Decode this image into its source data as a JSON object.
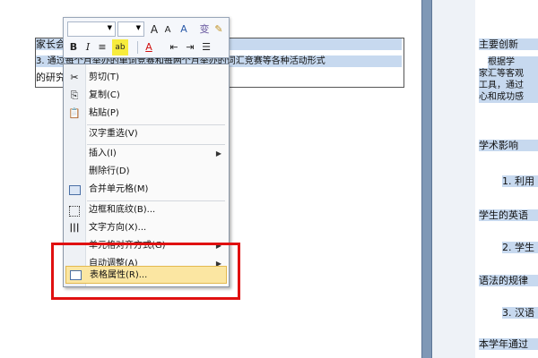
{
  "document": {
    "left_row1": "家长会",
    "left_row2": "3. 通过每个月举办的单词竞赛和每两个月举办的词汇竞赛等各种活动形式",
    "left_row3": "的研究",
    "right_lines": [
      "主要创新",
      "根据学",
      "家汇等客观",
      "工具，通过",
      "心和成功感",
      "学术影响",
      "1. 利用",
      "学生的英语",
      "2. 学生",
      "语法的规律",
      "3. 汉语",
      "本学年通过"
    ]
  },
  "minibar": {
    "font_name": "",
    "font_size": "",
    "grow": "A",
    "shrink": "A",
    "style": "A",
    "clear": "变",
    "bold": "B",
    "italic": "I",
    "center": "≡",
    "highlight": "ab",
    "fontcolor": "A",
    "outdent": "⇤",
    "indent": "⇥",
    "bullets": "☰"
  },
  "menu": {
    "items": [
      {
        "label": "剪切(T)",
        "icon": "cut-icon"
      },
      {
        "label": "复制(C)",
        "icon": "copy-icon"
      },
      {
        "label": "粘贴(P)",
        "icon": "paste-icon"
      },
      {
        "label": "汉字重选(V)",
        "icon": ""
      },
      {
        "label": "插入(I)",
        "icon": ""
      },
      {
        "label": "删除行(D)",
        "icon": ""
      },
      {
        "label": "合并单元格(M)",
        "icon": "merge-cells-icon"
      },
      {
        "label": "边框和底纹(B)...",
        "icon": "borders-icon"
      },
      {
        "label": "文字方向(X)...",
        "icon": "text-direction-icon"
      },
      {
        "label": "单元格对齐方式(G)",
        "icon": ""
      },
      {
        "label": "自动调整(A)",
        "icon": ""
      },
      {
        "label": "表格属性(R)...",
        "icon": "table-properties-icon"
      }
    ]
  },
  "colors": {
    "selection": "#c7d9ef",
    "highlight_border": "#e3b94f",
    "annotation_box": "#e01010"
  }
}
